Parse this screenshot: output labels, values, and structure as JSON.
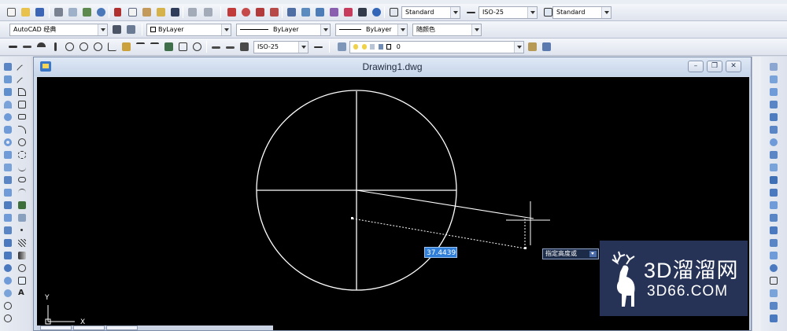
{
  "colors": {
    "canvas_bg": "#000000",
    "geometry": "#ffffff",
    "dimension_input_bg": "#2f7fd9",
    "tooltip_bg": "#1c2b48",
    "watermark_bg": "#28365c"
  },
  "toolbar": {
    "text_style": "Standard",
    "dim_style": "ISO-25",
    "table_style": "Standard",
    "workspace": "AutoCAD 经典",
    "layer_color": "ByLayer",
    "linetype": "ByLayer",
    "lineweight": "ByLayer",
    "plot_style": "随颜色",
    "dim_style_2": "ISO-25",
    "layer_name": "0"
  },
  "drawing_window": {
    "title": "Drawing1.dwg",
    "minimize_icon": "minimize-icon",
    "restore_icon": "restore-icon",
    "close_icon": "close-icon"
  },
  "canvas": {
    "dimension_value": "37.4439",
    "prompt_tooltip": "指定高度或",
    "ucs_x": "X",
    "ucs_y": "Y"
  },
  "watermark": {
    "brand": "3D溜溜网",
    "url": "3D66.COM"
  }
}
